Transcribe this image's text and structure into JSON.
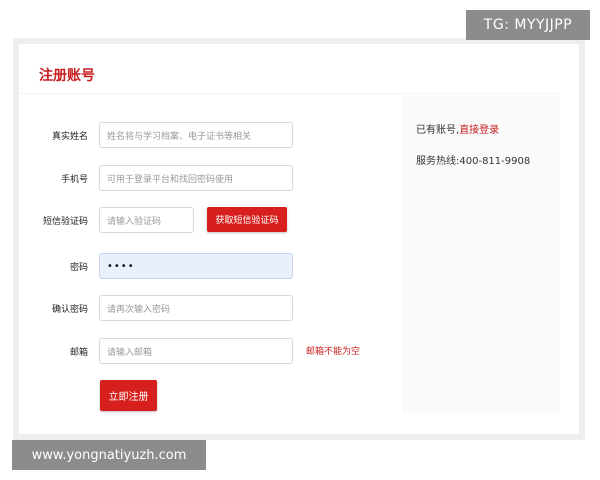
{
  "overlay": {
    "tag": "TG: MYYJJPP",
    "watermark": "www.yongnatiyuzh.com"
  },
  "form": {
    "title": "注册账号",
    "fields": {
      "name": {
        "label": "真实姓名",
        "placeholder": "姓名将与学习档案、电子证书等相关"
      },
      "phone": {
        "label": "手机号",
        "placeholder": "可用于登录平台和找回密码使用"
      },
      "sms": {
        "label": "短信验证码",
        "placeholder": "请输入验证码",
        "button": "获取短信验证码"
      },
      "password": {
        "label": "密码",
        "value": "••••"
      },
      "confirm": {
        "label": "确认密码",
        "placeholder": "请再次输入密码"
      },
      "email": {
        "label": "邮箱",
        "placeholder": "请输入邮箱",
        "error": "邮箱不能为空"
      }
    },
    "submit": "立即注册"
  },
  "side": {
    "have_account": "已有账号,",
    "login_link": "直接登录",
    "hotline": "服务热线:400-811-9908"
  },
  "colors": {
    "accent": "#d7201d",
    "filled_bg": "#e8f0fe"
  }
}
